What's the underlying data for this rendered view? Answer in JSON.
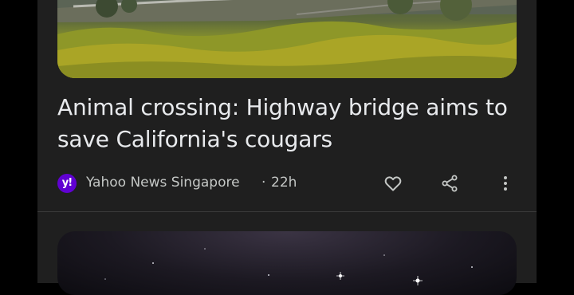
{
  "article": {
    "headline": "Animal crossing: Highway bridge aims to save California's cougars",
    "source": {
      "logo_text": "y!",
      "name": "Yahoo News Singapore",
      "separator": "·",
      "time": "22h",
      "logo_color": "#6001d2"
    },
    "actions": {
      "like_icon": "heart-outline-icon",
      "share_icon": "share-icon",
      "more_icon": "more-vertical-icon"
    }
  },
  "colors": {
    "background": "#1f1f1f",
    "headline": "#e8eaed",
    "meta": "#c4c7c5"
  }
}
